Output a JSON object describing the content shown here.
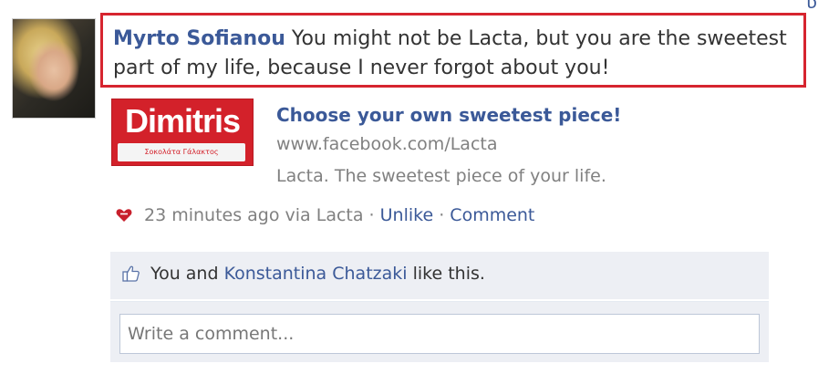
{
  "post": {
    "author": "Myrto Sofianou",
    "message": " You might not be Lacta, but you are the sweetest part of my life, because I never forgot about you!"
  },
  "attachment": {
    "thumbnail_text": "Dimitris",
    "thumbnail_subtext": "Σοκολάτα Γάλακτος",
    "title": "Choose your own sweetest piece!",
    "url": "www.facebook.com/Lacta",
    "description": "Lacta. The sweetest piece of your life."
  },
  "meta": {
    "timestamp": "23 minutes ago via Lacta",
    "separator": " · ",
    "unlike": "Unlike",
    "comment": "Comment"
  },
  "likes": {
    "prefix": "You and ",
    "other_user": "Konstantina Chatzaki",
    "suffix": " like this."
  },
  "comment_box": {
    "placeholder": "Write a comment..."
  },
  "colors": {
    "link": "#3b5998",
    "highlight_border": "#d6252f",
    "brand_red": "#d3212a",
    "ufi_background": "#edeff4"
  },
  "icons": {
    "app": "lacta-heart-icon",
    "like": "thumbs-up-icon"
  }
}
